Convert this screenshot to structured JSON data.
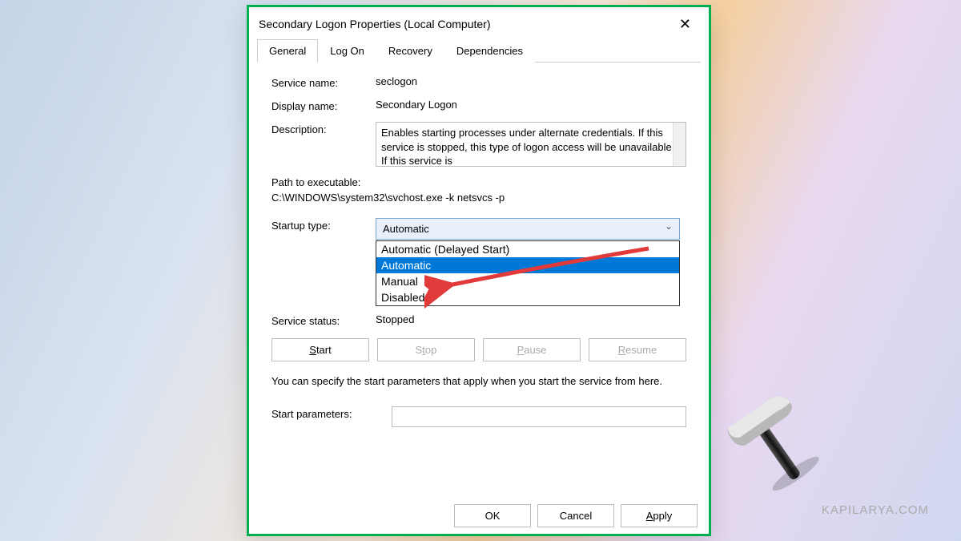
{
  "window": {
    "title": "Secondary Logon Properties (Local Computer)"
  },
  "tabs": {
    "general": "General",
    "logon": "Log On",
    "recovery": "Recovery",
    "dependencies": "Dependencies"
  },
  "labels": {
    "service_name": "Service name:",
    "display_name": "Display name:",
    "description": "Description:",
    "path_label": "Path to executable:",
    "startup_type": "Startup type:",
    "service_status": "Service status:",
    "start_parameters": "Start parameters:"
  },
  "values": {
    "service_name": "seclogon",
    "display_name": "Secondary Logon",
    "description": "Enables starting processes under alternate credentials. If this service is stopped, this type of logon access will be unavailable. If this service is",
    "path": "C:\\WINDOWS\\system32\\svchost.exe -k netsvcs -p",
    "startup_selected": "Automatic",
    "service_status": "Stopped",
    "start_parameters": ""
  },
  "dropdown_options": {
    "o1": "Automatic (Delayed Start)",
    "o2": "Automatic",
    "o3": "Manual",
    "o4": "Disabled"
  },
  "buttons": {
    "start": "Start",
    "stop": "Stop",
    "pause": "Pause",
    "resume": "Resume",
    "ok": "OK",
    "cancel": "Cancel",
    "apply": "Apply"
  },
  "note": "You can specify the start parameters that apply when you start the service from here.",
  "watermark": "KAPILARYA.COM"
}
